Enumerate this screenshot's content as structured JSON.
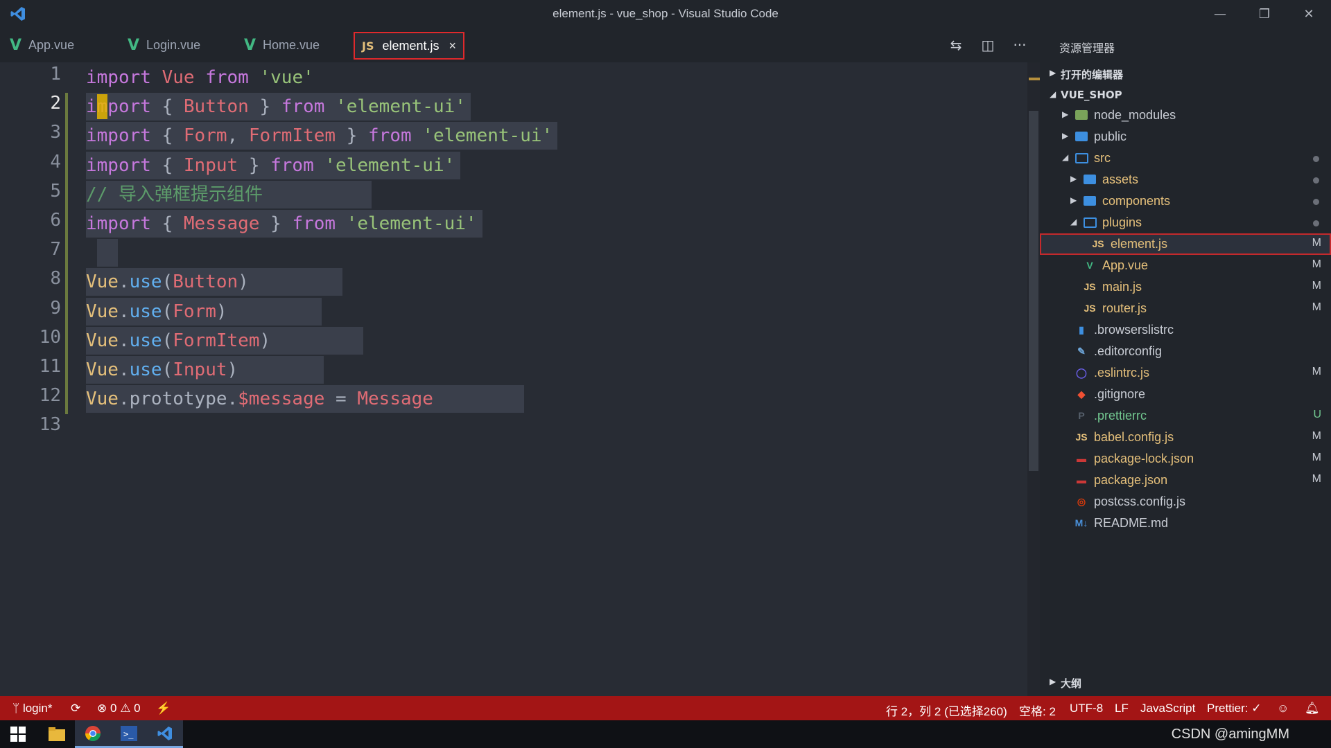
{
  "window": {
    "title": "element.js - vue_shop - Visual Studio Code",
    "controls": [
      "minimize",
      "restore",
      "close"
    ]
  },
  "tabs": [
    {
      "label": "App.vue",
      "icon": "vue-icon",
      "active": false
    },
    {
      "label": "Login.vue",
      "icon": "vue-icon",
      "active": false
    },
    {
      "label": "Home.vue",
      "icon": "vue-icon",
      "active": false
    },
    {
      "label": "element.js",
      "icon": "js-icon",
      "active": true,
      "close": "×"
    }
  ],
  "editor": {
    "line_numbers": [
      "1",
      "2",
      "3",
      "4",
      "5",
      "6",
      "7",
      "8",
      "9",
      "10",
      "11",
      "12",
      "13"
    ],
    "current_line": 2,
    "lines": [
      [
        {
          "t": "import ",
          "c": "kw"
        },
        {
          "t": "Vue ",
          "c": "cls"
        },
        {
          "t": "from ",
          "c": "kw"
        },
        {
          "t": "'vue'",
          "c": "str"
        }
      ],
      [
        {
          "t": "import ",
          "c": "kw"
        },
        {
          "t": "{ ",
          "c": "punc"
        },
        {
          "t": "Button ",
          "c": "cls"
        },
        {
          "t": "} ",
          "c": "punc"
        },
        {
          "t": "from ",
          "c": "kw"
        },
        {
          "t": "'element-ui'",
          "c": "str"
        }
      ],
      [
        {
          "t": "import ",
          "c": "kw"
        },
        {
          "t": "{ ",
          "c": "punc"
        },
        {
          "t": "Form",
          "c": "cls"
        },
        {
          "t": ", ",
          "c": "punc"
        },
        {
          "t": "FormItem ",
          "c": "cls"
        },
        {
          "t": "} ",
          "c": "punc"
        },
        {
          "t": "from ",
          "c": "kw"
        },
        {
          "t": "'element-ui'",
          "c": "str"
        }
      ],
      [
        {
          "t": "import ",
          "c": "kw"
        },
        {
          "t": "{ ",
          "c": "punc"
        },
        {
          "t": "Input ",
          "c": "cls"
        },
        {
          "t": "} ",
          "c": "punc"
        },
        {
          "t": "from ",
          "c": "kw"
        },
        {
          "t": "'element-ui'",
          "c": "str"
        }
      ],
      [
        {
          "t": "// 导入弹框提示组件",
          "c": "cmt"
        }
      ],
      [
        {
          "t": "import ",
          "c": "kw"
        },
        {
          "t": "{ ",
          "c": "punc"
        },
        {
          "t": "Message ",
          "c": "cls"
        },
        {
          "t": "} ",
          "c": "punc"
        },
        {
          "t": "from ",
          "c": "kw"
        },
        {
          "t": "'element-ui'",
          "c": "str"
        }
      ],
      [],
      [
        {
          "t": "Vue",
          "c": "obj"
        },
        {
          "t": ".",
          "c": "punc"
        },
        {
          "t": "use",
          "c": "fn"
        },
        {
          "t": "(",
          "c": "punc"
        },
        {
          "t": "Button",
          "c": "cls"
        },
        {
          "t": ")",
          "c": "punc"
        }
      ],
      [
        {
          "t": "Vue",
          "c": "obj"
        },
        {
          "t": ".",
          "c": "punc"
        },
        {
          "t": "use",
          "c": "fn"
        },
        {
          "t": "(",
          "c": "punc"
        },
        {
          "t": "Form",
          "c": "cls"
        },
        {
          "t": ")",
          "c": "punc"
        }
      ],
      [
        {
          "t": "Vue",
          "c": "obj"
        },
        {
          "t": ".",
          "c": "punc"
        },
        {
          "t": "use",
          "c": "fn"
        },
        {
          "t": "(",
          "c": "punc"
        },
        {
          "t": "FormItem",
          "c": "cls"
        },
        {
          "t": ")",
          "c": "punc"
        }
      ],
      [
        {
          "t": "Vue",
          "c": "obj"
        },
        {
          "t": ".",
          "c": "punc"
        },
        {
          "t": "use",
          "c": "fn"
        },
        {
          "t": "(",
          "c": "punc"
        },
        {
          "t": "Input",
          "c": "cls"
        },
        {
          "t": ")",
          "c": "punc"
        }
      ],
      [
        {
          "t": "Vue",
          "c": "obj"
        },
        {
          "t": ".prototype.",
          "c": "punc"
        },
        {
          "t": "$message ",
          "c": "var"
        },
        {
          "t": "= ",
          "c": "punc"
        },
        {
          "t": "Message",
          "c": "cls"
        }
      ],
      []
    ]
  },
  "sidebar": {
    "header": "资源管理器",
    "open_editors": "打开的编辑器",
    "project": "VUE_SHOP",
    "outline": "大纲",
    "items": [
      {
        "label": "node_modules",
        "icon": "folder-node-icon",
        "depth": 1,
        "arrow": "▶",
        "badge": "",
        "dot": false,
        "color": "#c8ccd4"
      },
      {
        "label": "public",
        "icon": "folder-icon",
        "depth": 1,
        "arrow": "▶",
        "badge": "",
        "dot": false,
        "color": "#c8ccd4"
      },
      {
        "label": "src",
        "icon": "folder-open-icon",
        "depth": 1,
        "arrow": "◢",
        "badge": "",
        "dot": true,
        "color": "#e5c07b"
      },
      {
        "label": "assets",
        "icon": "folder-icon",
        "depth": 2,
        "arrow": "▶",
        "badge": "",
        "dot": true,
        "color": "#e5c07b"
      },
      {
        "label": "components",
        "icon": "folder-icon",
        "depth": 2,
        "arrow": "▶",
        "badge": "",
        "dot": true,
        "color": "#e5c07b"
      },
      {
        "label": "plugins",
        "icon": "folder-open-icon",
        "depth": 2,
        "arrow": "◢",
        "badge": "",
        "dot": true,
        "color": "#e5c07b"
      },
      {
        "label": "element.js",
        "icon": "js-icon",
        "depth": 3,
        "arrow": "",
        "badge": "M",
        "dot": false,
        "color": "#e5c07b",
        "selected": true
      },
      {
        "label": "App.vue",
        "icon": "vue-icon",
        "depth": 2,
        "arrow": "",
        "badge": "M",
        "dot": false,
        "color": "#e5c07b"
      },
      {
        "label": "main.js",
        "icon": "js-icon",
        "depth": 2,
        "arrow": "",
        "badge": "M",
        "dot": false,
        "color": "#e5c07b"
      },
      {
        "label": "router.js",
        "icon": "js-icon",
        "depth": 2,
        "arrow": "",
        "badge": "M",
        "dot": false,
        "color": "#e5c07b"
      },
      {
        "label": ".browserslistrc",
        "icon": "file-icon",
        "depth": 1,
        "arrow": "",
        "badge": "",
        "dot": false,
        "color": "#c8ccd4"
      },
      {
        "label": ".editorconfig",
        "icon": "editorconfig-icon",
        "depth": 1,
        "arrow": "",
        "badge": "",
        "dot": false,
        "color": "#c8ccd4"
      },
      {
        "label": ".eslintrc.js",
        "icon": "eslint-icon",
        "depth": 1,
        "arrow": "",
        "badge": "M",
        "dot": false,
        "color": "#e5c07b"
      },
      {
        "label": ".gitignore",
        "icon": "git-icon",
        "depth": 1,
        "arrow": "",
        "badge": "",
        "dot": false,
        "color": "#c8ccd4"
      },
      {
        "label": ".prettierrc",
        "icon": "prettier-icon",
        "depth": 1,
        "arrow": "",
        "badge": "U",
        "dot": false,
        "color": "#73c991"
      },
      {
        "label": "babel.config.js",
        "icon": "js-icon",
        "depth": 1,
        "arrow": "",
        "badge": "M",
        "dot": false,
        "color": "#e5c07b"
      },
      {
        "label": "package-lock.json",
        "icon": "npm-icon",
        "depth": 1,
        "arrow": "",
        "badge": "M",
        "dot": false,
        "color": "#e5c07b"
      },
      {
        "label": "package.json",
        "icon": "npm-icon",
        "depth": 1,
        "arrow": "",
        "badge": "M",
        "dot": false,
        "color": "#e5c07b"
      },
      {
        "label": "postcss.config.js",
        "icon": "postcss-icon",
        "depth": 1,
        "arrow": "",
        "badge": "",
        "dot": false,
        "color": "#c8ccd4"
      },
      {
        "label": "README.md",
        "icon": "markdown-icon",
        "depth": 1,
        "arrow": "",
        "badge": "",
        "dot": false,
        "color": "#c8ccd4"
      }
    ]
  },
  "statusbar": {
    "branch": "login*",
    "errors": "0",
    "warnings": "0",
    "position": "行 2，列 2 (已选择260)",
    "spaces": "空格: 2",
    "encoding": "UTF-8",
    "eol": "LF",
    "language": "JavaScript",
    "formatter": "Prettier: ✓",
    "color": "#a31515"
  },
  "taskbar": {
    "watermark": "CSDN @amingMM"
  }
}
